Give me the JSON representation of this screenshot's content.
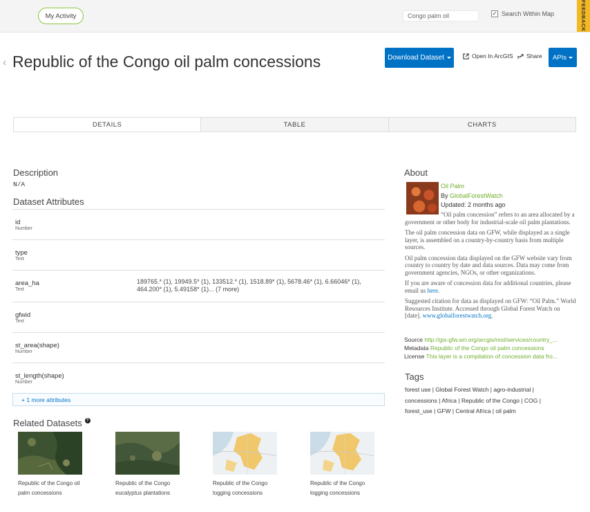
{
  "header": {
    "my_activity": "My Activity",
    "search_value": "Congo palm oil",
    "search_within_map": "Search Within Map",
    "feedback": "FEEDBACK"
  },
  "page": {
    "title": "Republic of the Congo oil palm concessions",
    "download_label": "Download Dataset",
    "open_arcgis": "Open In ArcGIS",
    "share": "Share",
    "apis": "APIs"
  },
  "tabs": [
    "DETAILS",
    "TABLE",
    "CHARTS"
  ],
  "details": {
    "description_heading": "Description",
    "description_value": "N/A",
    "attributes_heading": "Dataset Attributes",
    "attributes": [
      {
        "name": "id",
        "type": "Number",
        "value": ""
      },
      {
        "name": "type",
        "type": "Text",
        "value": ""
      },
      {
        "name": "area_ha",
        "type": "Text",
        "value": "189765.* (1), 19949.5* (1), 133512.* (1), 1518.89* (1), 5678.46* (1), 6.66046* (1), 464.200* (1), 5.49158* (1)... (7 more)"
      },
      {
        "name": "gfwid",
        "type": "Text",
        "value": ""
      },
      {
        "name": "st_area(shape)",
        "type": "Number",
        "value": ""
      },
      {
        "name": "st_length(shape)",
        "type": "Number",
        "value": ""
      }
    ],
    "more_attributes": "+ 1 more attributes",
    "related_heading": "Related Datasets",
    "related": [
      {
        "line1": "Republic of the Congo oil",
        "line2": "palm concessions",
        "kind": "satellite"
      },
      {
        "line1": "Republic of the Congo",
        "line2": "eucalyptus plantations",
        "kind": "satellite"
      },
      {
        "line1": "Republic of the Congo",
        "line2": "logging concessions",
        "kind": "map"
      },
      {
        "line1": "Republic of the Congo",
        "line2": "logging concessions",
        "kind": "map"
      }
    ]
  },
  "about": {
    "heading": "About",
    "name": "Oil Palm",
    "by_prefix": "By ",
    "by_owner": "GlobalForestWatch",
    "updated": "Updated: 2 months ago",
    "p1": "“Oil palm concession” refers to an area allocated by a government or other body for industrial-scale oil palm plantations.",
    "p2": "The oil palm concession data on GFW, while displayed as a single layer, is assembled on a country-by-country basis from multiple sources.",
    "p3": "Oil palm concession data displayed on the GFW website vary from country to country by date and data sources. Data may come from government agencies, NGOs, or other organizations.",
    "p4_pre": "If you are aware of concession data for additional countries, please email us ",
    "p4_link": "here",
    "p4_post": ".",
    "p5_pre": "Suggested citation for data as displayed on GFW: “Oil Palm.” World Resources Institute. Accessed through Global Forest Watch on [date]. ",
    "p5_link": "www.globalforestwatch.org",
    "p5_post": ".",
    "source_label": "Source",
    "source_value": "http://gis-gfw.wri.org/arcgis/rest/services/country_...",
    "metadata_label": "Metadata",
    "metadata_value": "Republic of the Congo oil palm concessions",
    "license_label": "License",
    "license_value": "This layer is a compilation of concession data fro...",
    "tags_heading": "Tags",
    "tags": [
      "forest use",
      "Global Forest Watch",
      "agro-industrial",
      "concessions",
      "Africa",
      "Republic of the Congo",
      "COG",
      "forest_use",
      "GFW",
      "Central Africa",
      "oil palm"
    ]
  },
  "colors": {
    "accent": "#0072c6",
    "link_green": "#6fae2b",
    "feedback": "#f4b822"
  }
}
